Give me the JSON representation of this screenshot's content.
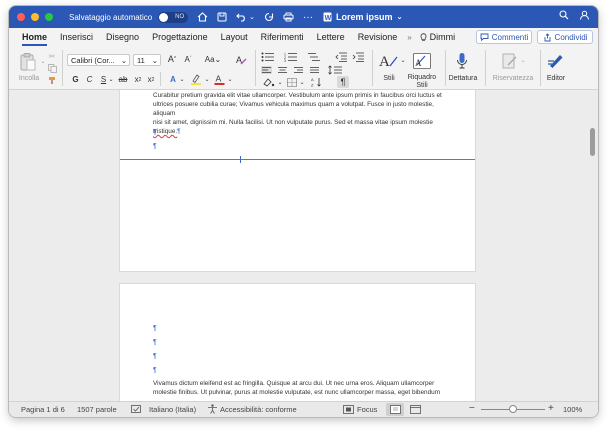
{
  "titlebar": {
    "autosave_label": "Salvataggio automatico",
    "autosave_state": "NO",
    "doc_title": "Lorem ipsum",
    "colors": {
      "close": "#ff5f57",
      "minimize": "#febc2e",
      "maximize": "#28c840",
      "bar": "#2b57b5"
    }
  },
  "tabs": [
    {
      "label": "Home"
    },
    {
      "label": "Inserisci"
    },
    {
      "label": "Disegno"
    },
    {
      "label": "Progettazione"
    },
    {
      "label": "Layout"
    },
    {
      "label": "Riferimenti"
    },
    {
      "label": "Lettere"
    },
    {
      "label": "Revisione"
    }
  ],
  "tell_me": "Dimmi",
  "comments_label": "Commenti",
  "share_label": "Condividi",
  "ribbon": {
    "paste_label": "Incolla",
    "font_name": "Calibri (Cor...",
    "font_size": "11",
    "styles_label": "Stili",
    "styles_pane_label_1": "Riquadro",
    "styles_pane_label_2": "Stili",
    "dictate_label": "Dettatura",
    "sensitivity_label": "Riservatezza",
    "editor_label": "Editor"
  },
  "page1": {
    "line1": "Curabitur pretium gravida elit vitae ullamcorper. Vestibulum ante ipsum primis in faucibus orci luctus et",
    "line2": "ultrices posuere cubilia curae; Vivamus vehicula maximus quam a volutpat. Fusce in justo molestie, aliquam",
    "line3": "nisi sit amet, dignissim mi. Nulla facilisi. Ut non vulputate purus. Sed et massa vitae ipsum molestie",
    "line4": "tristique.",
    "pilcrow": "¶"
  },
  "page2": {
    "line1": "Vivamus dictum eleifend est ac fringilla. Quisque at arcu dui. Ut nec urna eros. Aliquam ullamcorper",
    "line2": "molestie finibus. Ut pulvinar, purus at molestie vulputate, est nunc ullamcorper massa, eget bibendum"
  },
  "status": {
    "page": "Pagina 1 di 6",
    "words": "1507 parole",
    "language": "Italiano (Italia)",
    "accessibility": "Accessibilità: conforme",
    "focus": "Focus",
    "zoom": "100%",
    "zoom_value": 1.0
  }
}
